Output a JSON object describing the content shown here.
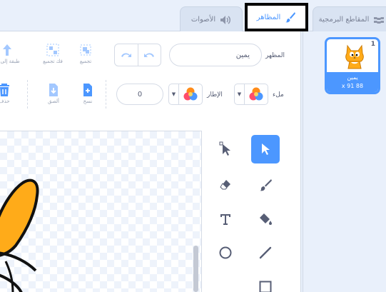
{
  "tabs": {
    "code": "المقاطع البرمجية",
    "costumes": "المظاهر",
    "sounds": "الأصوات"
  },
  "sprite": {
    "number": "1",
    "name": "يمين",
    "coords": "x 91 88"
  },
  "costume_editor": {
    "costume_label": "المظهر",
    "costume_name": "يمين",
    "group_label": "تجميع",
    "ungroup_label": "فك تجميع",
    "forward_label": "طبقة إلى الأ",
    "fill_label": "ملء",
    "outline_label": "الإطار",
    "outline_width": "0",
    "copy_label": "نسخ",
    "paste_label": "ألصق",
    "delete_label": "حذف"
  },
  "colors": {
    "accent": "#4c97ff",
    "highlight_border": "#000000",
    "cat_orange": "#ffab19"
  },
  "tools": [
    "select-tool",
    "reshape-tool",
    "brush-tool",
    "eraser-tool",
    "fill-tool",
    "text-tool",
    "line-tool",
    "circle-tool",
    "rectangle-tool"
  ]
}
